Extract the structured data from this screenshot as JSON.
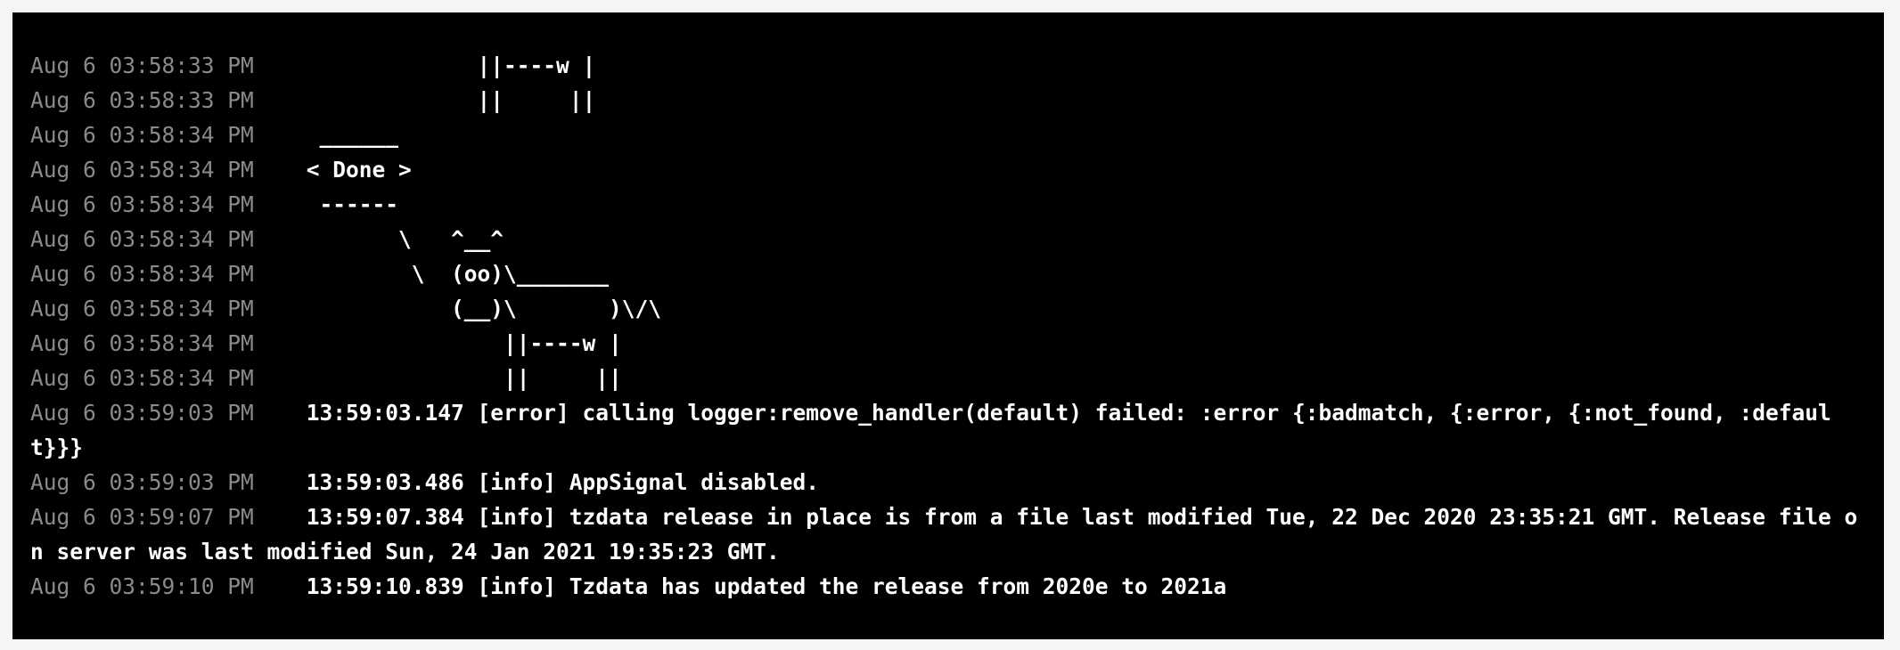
{
  "log": {
    "lines": [
      {
        "ts": "Aug 6 03:58:33 PM",
        "msg": "              ||----w |"
      },
      {
        "ts": "Aug 6 03:58:33 PM",
        "msg": "              ||     ||"
      },
      {
        "ts": "Aug 6 03:58:34 PM",
        "msg": "  ______"
      },
      {
        "ts": "Aug 6 03:58:34 PM",
        "msg": " < Done >"
      },
      {
        "ts": "Aug 6 03:58:34 PM",
        "msg": "  ------"
      },
      {
        "ts": "Aug 6 03:58:34 PM",
        "msg": "        \\   ^__^"
      },
      {
        "ts": "Aug 6 03:58:34 PM",
        "msg": "         \\  (oo)\\_______"
      },
      {
        "ts": "Aug 6 03:58:34 PM",
        "msg": "            (__)\\       )\\/\\"
      },
      {
        "ts": "Aug 6 03:58:34 PM",
        "msg": "                ||----w |"
      },
      {
        "ts": "Aug 6 03:58:34 PM",
        "msg": "                ||     ||"
      },
      {
        "ts": "Aug 6 03:59:03 PM",
        "msg": " 13:59:03.147 [error] calling logger:remove_handler(default) failed: :error {:badmatch, {:error, {:not_found, :default}}}"
      },
      {
        "ts": "Aug 6 03:59:03 PM",
        "msg": " 13:59:03.486 [info] AppSignal disabled."
      },
      {
        "ts": "Aug 6 03:59:07 PM",
        "msg": " 13:59:07.384 [info] tzdata release in place is from a file last modified Tue, 22 Dec 2020 23:35:21 GMT. Release file on server was last modified Sun, 24 Jan 2021 19:35:23 GMT."
      },
      {
        "ts": "Aug 6 03:59:10 PM",
        "msg": " 13:59:10.839 [info] Tzdata has updated the release from 2020e to 2021a"
      }
    ]
  }
}
